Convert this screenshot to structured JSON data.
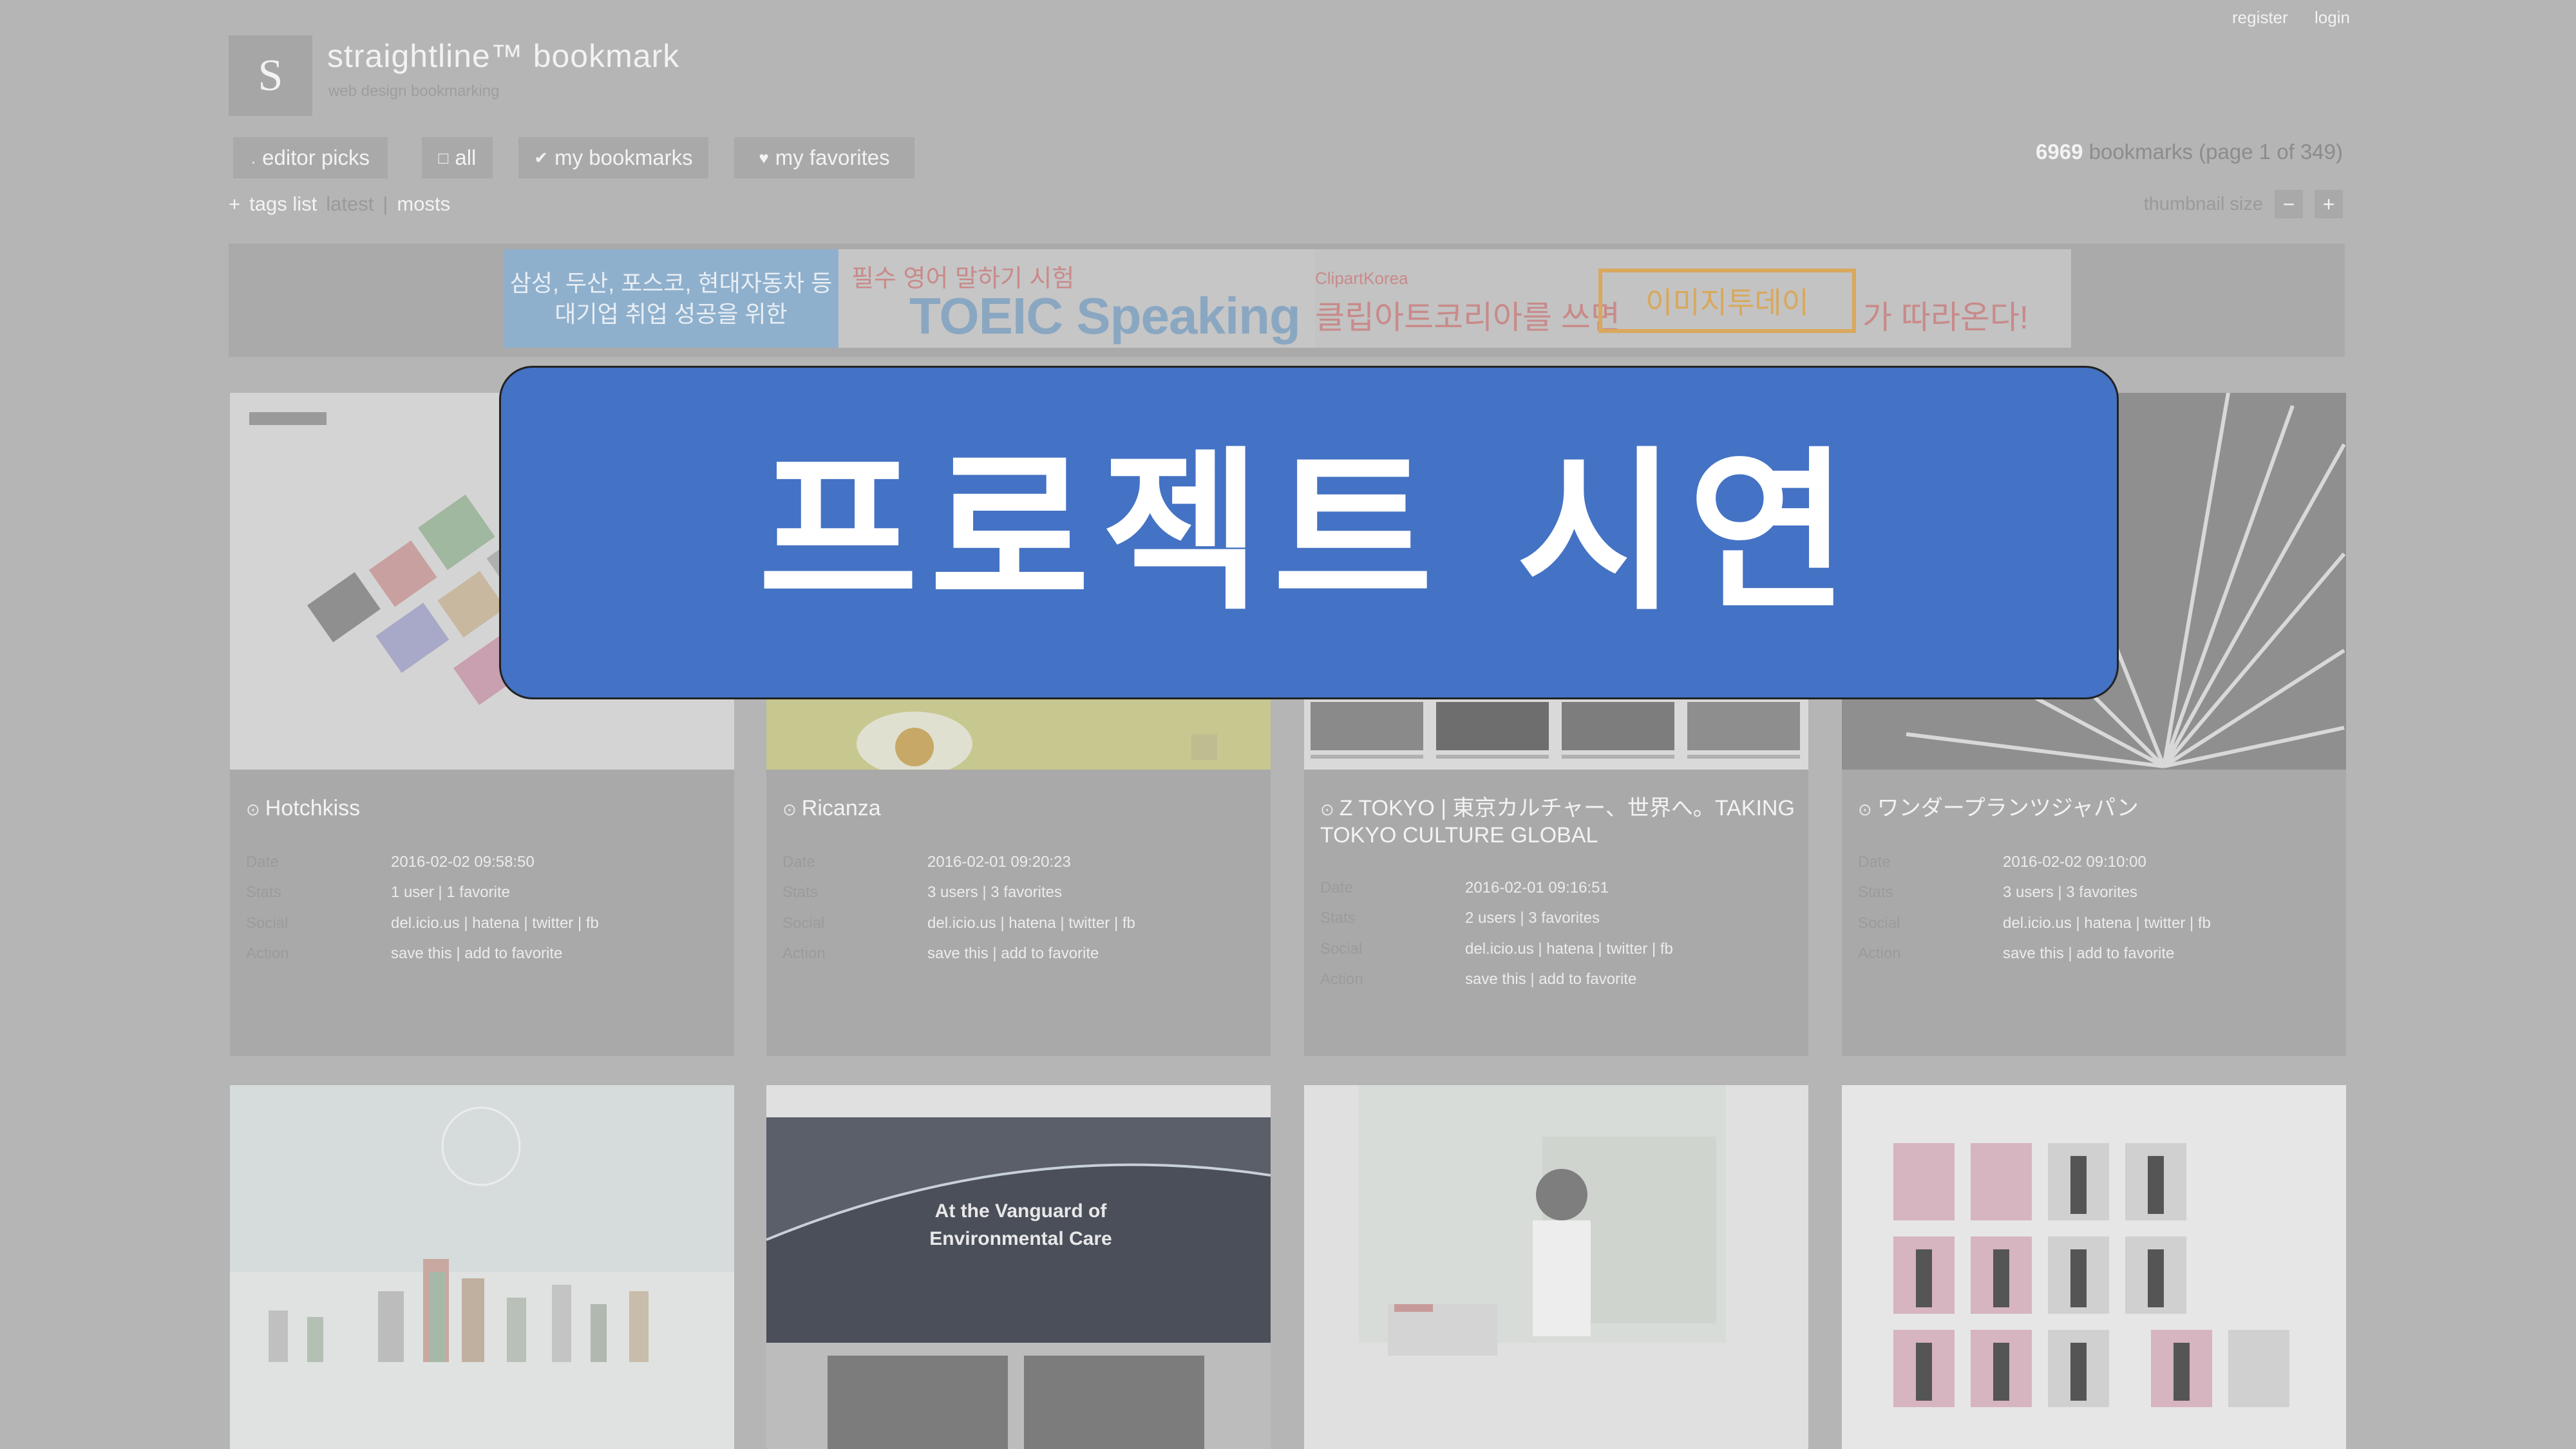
{
  "auth": {
    "register": "register",
    "login": "login"
  },
  "brand": {
    "logo_letter": "S",
    "title": "straightline™ bookmark",
    "subtitle": "web design bookmarking"
  },
  "nav": [
    {
      "icon": "editor-picks-icon",
      "label": "editor picks"
    },
    {
      "icon": "all-icon",
      "label": "all"
    },
    {
      "icon": "check-icon",
      "label": "my bookmarks"
    },
    {
      "icon": "heart-icon",
      "label": "my favorites"
    }
  ],
  "count": {
    "number": "6969",
    "suffix": "bookmarks (page 1 of 349)"
  },
  "tags": {
    "toggle": "+",
    "label": "tags list",
    "sep1": "latest",
    "pipe": "|",
    "sep2": "mosts"
  },
  "thumbnail_size": {
    "label": "thumbnail size",
    "minus": "−",
    "plus": "+"
  },
  "ads": {
    "ad1_line1": "삼성, 두산, 포스코, 현대자동차 등",
    "ad1_line2": "대기업 취업 성공을 위한",
    "ad2_line1": "필수 영어 말하기 시험",
    "ad2_line2": "TOEIC Speaking",
    "ad3_brand": "ClipartKorea",
    "ad3_line1": "클립아트코리아를 쓰면",
    "ad3_bracket": "이미지투데이",
    "ad3_line2": "가 따라온다!"
  },
  "cards": [
    {
      "title": "Hotchkiss",
      "date_label": "Date",
      "date": "2016-02-02 09:58:50",
      "stats_label": "Stats",
      "stats": "1 user | 1 favorite",
      "social_label": "Social",
      "social": "del.icio.us | hatena | twitter | fb",
      "action_label": "Action",
      "action": "save this | add to favorite"
    },
    {
      "title": "Ricanza",
      "date_label": "Date",
      "date": "2016-02-01 09:20:23",
      "stats_label": "Stats",
      "stats": "3 users | 3 favorites",
      "social_label": "Social",
      "social": "del.icio.us | hatena | twitter | fb",
      "action_label": "Action",
      "action": "save this | add to favorite"
    },
    {
      "title": "Z TOKYO | 東京カルチャー、世界へ。TAKING TOKYO CULTURE GLOBAL",
      "date_label": "Date",
      "date": "2016-02-01 09:16:51",
      "stats_label": "Stats",
      "stats": "2 users | 3 favorites",
      "social_label": "Social",
      "social": "del.icio.us | hatena | twitter | fb",
      "action_label": "Action",
      "action": "save this | add to favorite"
    },
    {
      "title": "ワンダープランツジャパン",
      "date_label": "Date",
      "date": "2016-02-02 09:10:00",
      "stats_label": "Stats",
      "stats": "3 users | 3 favorites",
      "social_label": "Social",
      "social": "del.icio.us | hatena | twitter | fb",
      "action_label": "Action",
      "action": "save this | add to favorite"
    }
  ],
  "bottom": {
    "vanguard_line1": "At the Vanguard of",
    "vanguard_line2": "Environmental Care"
  },
  "banner": {
    "text": "프로젝트 시연"
  },
  "colors": {
    "banner_bg": "#4472c4",
    "page_bg": "#b5b5b5"
  }
}
